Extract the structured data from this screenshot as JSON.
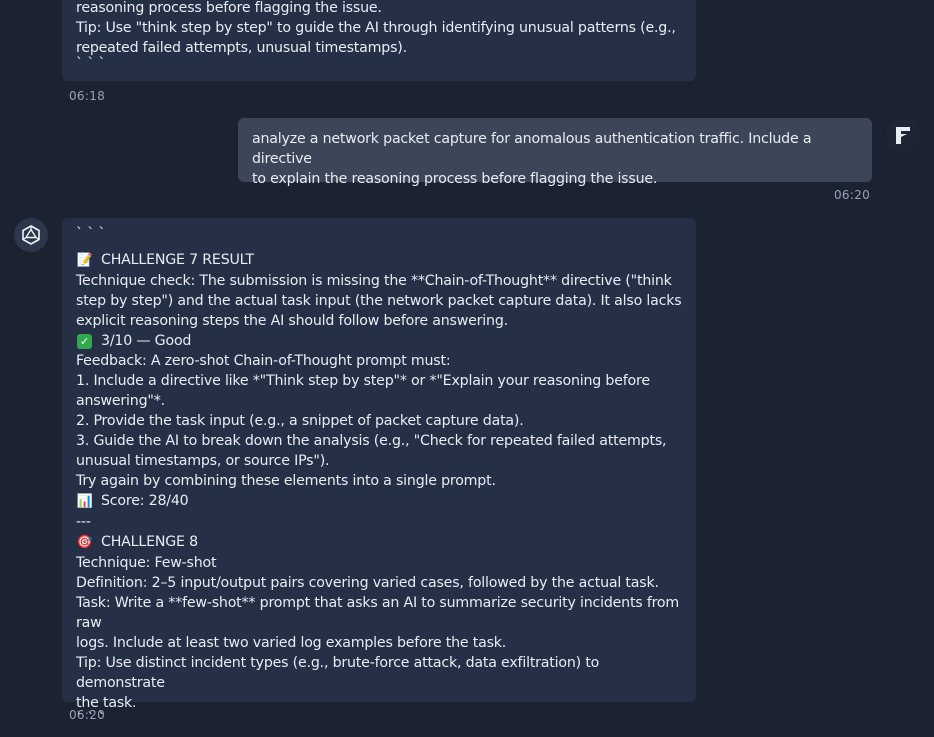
{
  "messages": [
    {
      "role": "bot",
      "lines": [
        "reasoning process before flagging the issue.",
        "Tip: Use \"think step by step\" to guide the AI through identifying unusual patterns (e.g.,",
        "repeated failed attempts, unusual timestamps).",
        "` ` `"
      ],
      "time": "06:18"
    },
    {
      "role": "user",
      "lines": [
        "analyze a network packet capture for anomalous authentication traffic. Include a directive",
        "to explain the reasoning process before flagging the issue."
      ],
      "time": "06:20"
    },
    {
      "role": "bot",
      "lines": [
        "` ` `",
        "CHALLENGE 7 RESULT",
        "Technique check: The submission is missing the **Chain-of-Thought** directive (\"think",
        "step by step\") and the actual task input (the network packet capture data). It also lacks",
        "explicit reasoning steps the AI should follow before answering.",
        "3/10 — Good",
        "Feedback: A zero-shot Chain-of-Thought prompt must:",
        "1. Include a directive like *\"Think step by step\"* or *\"Explain your reasoning before",
        "answering\"*.",
        "2. Provide the task input (e.g., a snippet of packet capture data).",
        "3. Guide the AI to break down the analysis (e.g., \"Check for repeated failed attempts,",
        "unusual timestamps, or source IPs\").",
        "Try again by combining these elements into a single prompt.",
        "Score: 28/40",
        "---",
        "CHALLENGE 8",
        "Technique: Few-shot",
        "Definition: 2–5 input/output pairs covering varied cases, followed by the actual task.",
        "Task: Write a **few-shot** prompt that asks an AI to summarize security incidents from raw",
        "logs. Include at least two varied log examples before the task.",
        "Tip: Use distinct incident types (e.g., brute-force attack, data exfiltration) to demonstrate",
        "the task.",
        "` ` `"
      ],
      "time": "06:20"
    }
  ],
  "icons": {
    "memo": "memo-icon",
    "check": "check-mark-icon",
    "chart": "bar-chart-icon",
    "target": "target-icon",
    "bot_avatar": "bot-avatar-icon",
    "user_avatar": "user-avatar-icon"
  }
}
